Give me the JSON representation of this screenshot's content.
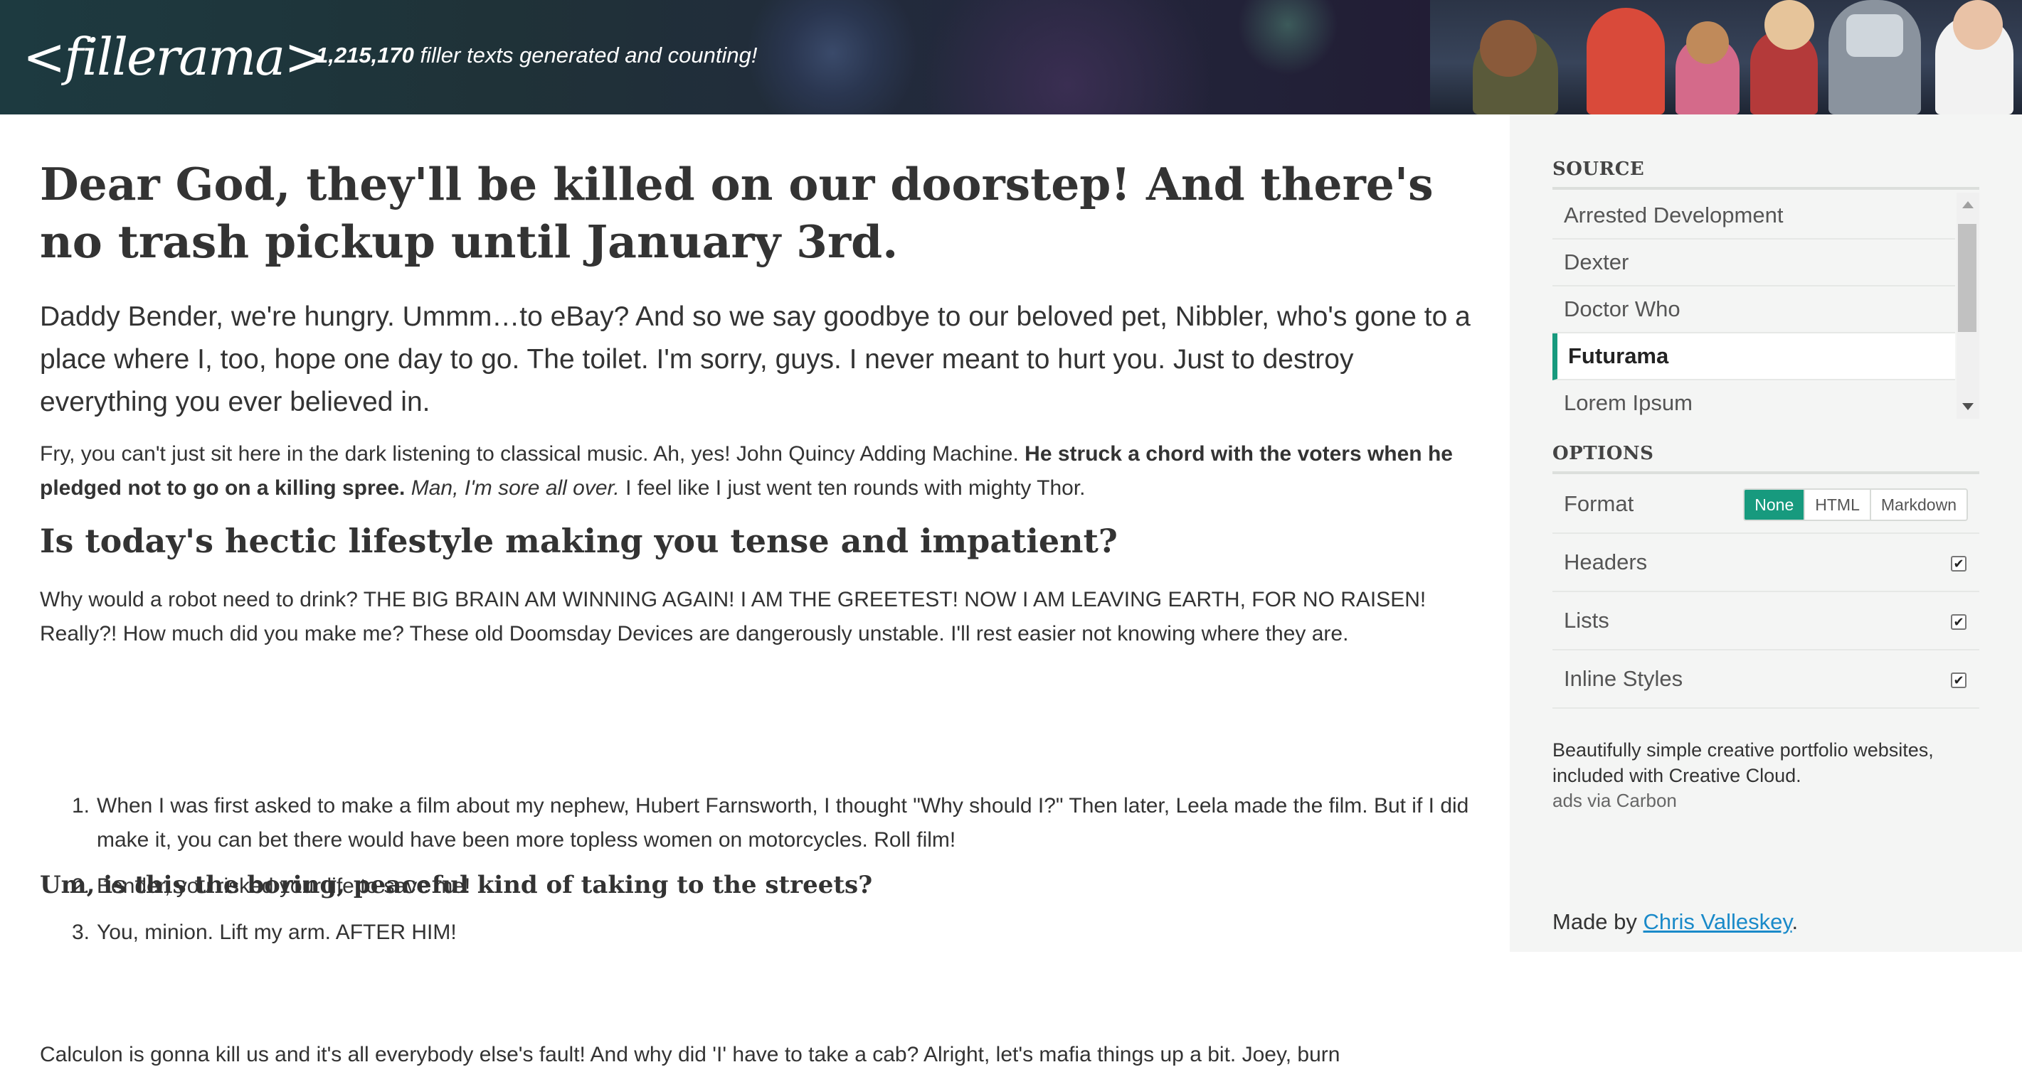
{
  "header": {
    "logo": "<fillerama>",
    "count": "1,215,170",
    "tagline_rest": " filler texts generated and counting!"
  },
  "article": {
    "title": "Dear God, they'll be killed on our doorstep! And there's no trash pickup until January 3rd.",
    "lead": "Daddy Bender, we're hungry. Ummm…to eBay? And so we say goodbye to our beloved pet, Nibbler, who's gone to a place where I, too, hope one day to go. The toilet. I'm sorry, guys. I never meant to hurt you. Just to destroy everything you ever believed in.",
    "p1_start": "Fry, you can't just sit here in the dark listening to classical music. Ah, yes! John Quincy Adding Machine. ",
    "p1_bold": "He struck a chord with the voters when he pledged not to go on a killing spree.",
    "p1_italic": "Man, I'm sore all over.",
    "p1_end": " I feel like I just went ten rounds with mighty Thor.",
    "h2": "Is today's hectic lifestyle making you tense and impatient?",
    "p2": "Why would a robot need to drink? THE BIG BRAIN AM WINNING AGAIN! I AM THE GREETEST! NOW I AM LEAVING EARTH, FOR NO RAISEN! Really?! How much did you make me? These old Doomsday Devices are dangerously unstable. I'll rest easier not knowing where they are.",
    "list": [
      {
        "num": "1.",
        "text": "When I was first asked to make a film about my nephew, Hubert Farnsworth, I thought \"Why should I?\" Then later, Leela made the film. But if I did make it, you can bet there would have been more topless women on motorcycles. Roll film!"
      },
      {
        "num": "2.",
        "text": "Bender, you risked your life to save me!"
      },
      {
        "num": "3.",
        "text": "You, minion. Lift my arm. AFTER HIM!"
      }
    ],
    "h3": "Um, is this the boring, peaceful kind of taking to the streets?",
    "p3": "Calculon is gonna kill us and it's all everybody else's fault! And why did 'I' have to take a cab? Alright, let's mafia things up a bit. Joey, burn"
  },
  "sidebar": {
    "source_title": "SOURCE",
    "sources": [
      {
        "label": "Arrested Development",
        "active": false
      },
      {
        "label": "Dexter",
        "active": false
      },
      {
        "label": "Doctor Who",
        "active": false
      },
      {
        "label": "Futurama",
        "active": true
      },
      {
        "label": "Lorem Ipsum",
        "active": false
      }
    ],
    "options_title": "OPTIONS",
    "format_label": "Format",
    "format_options": [
      "None",
      "HTML",
      "Markdown"
    ],
    "format_selected": "None",
    "headers_label": "Headers",
    "lists_label": "Lists",
    "inline_label": "Inline Styles",
    "headers_checked": true,
    "lists_checked": true,
    "inline_checked": true,
    "ad_text": "Beautifully simple creative portfolio websites, included with Creative Cloud.",
    "ad_via": "ads via Carbon",
    "made_by_prefix": "Made by ",
    "made_by_name": "Chris Valleskey",
    "made_by_suffix": "."
  },
  "colors": {
    "accent": "#179a7e",
    "link": "#1a8ac9",
    "header_bg": "#1f3238",
    "sidebar_bg": "#f4f5f4"
  }
}
